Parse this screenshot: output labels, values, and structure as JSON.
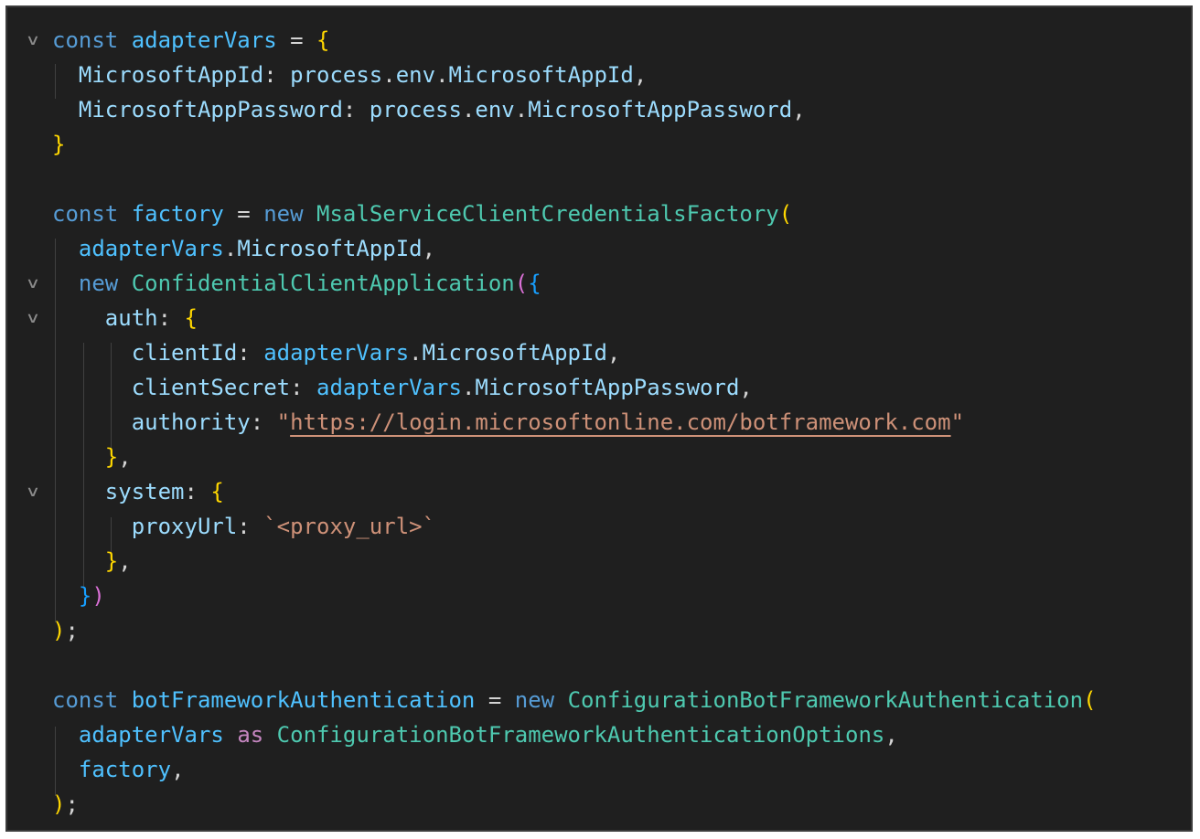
{
  "editor": {
    "theme": {
      "background": "#1f1f1f",
      "keyword": "#569cd6",
      "type": "#4ec9b0",
      "string": "#ce9178",
      "property": "#9cdcfe",
      "bracket_1": "#ffd700",
      "bracket_2": "#da70d6",
      "bracket_3": "#179fff"
    },
    "fold_icon": "chevron-down-icon",
    "lines": [
      {
        "fold": true,
        "tokens": [
          [
            "kw",
            "const"
          ],
          [
            "p",
            " "
          ],
          [
            "var",
            "adapterVars"
          ],
          [
            "p",
            " = "
          ],
          [
            "b1",
            "{"
          ]
        ]
      },
      {
        "fold": false,
        "tokens": [
          [
            "p",
            "  "
          ],
          [
            "prop",
            "MicrosoftAppId"
          ],
          [
            "p",
            ": "
          ],
          [
            "prop",
            "process"
          ],
          [
            "p",
            "."
          ],
          [
            "prop",
            "env"
          ],
          [
            "p",
            "."
          ],
          [
            "prop",
            "MicrosoftAppId"
          ],
          [
            "p",
            ","
          ]
        ]
      },
      {
        "fold": false,
        "tokens": [
          [
            "p",
            "  "
          ],
          [
            "prop",
            "MicrosoftAppPassword"
          ],
          [
            "p",
            ": "
          ],
          [
            "prop",
            "process"
          ],
          [
            "p",
            "."
          ],
          [
            "prop",
            "env"
          ],
          [
            "p",
            "."
          ],
          [
            "prop",
            "MicrosoftAppPassword"
          ],
          [
            "p",
            ","
          ]
        ]
      },
      {
        "fold": false,
        "tokens": [
          [
            "b1",
            "}"
          ]
        ]
      },
      {
        "fold": false,
        "tokens": []
      },
      {
        "fold": false,
        "tokens": [
          [
            "kw",
            "const"
          ],
          [
            "p",
            " "
          ],
          [
            "var",
            "factory"
          ],
          [
            "p",
            " = "
          ],
          [
            "kw",
            "new"
          ],
          [
            "p",
            " "
          ],
          [
            "cls",
            "MsalServiceClientCredentialsFactory"
          ],
          [
            "b1",
            "("
          ]
        ]
      },
      {
        "fold": false,
        "tokens": [
          [
            "p",
            "  "
          ],
          [
            "var",
            "adapterVars"
          ],
          [
            "p",
            "."
          ],
          [
            "prop",
            "MicrosoftAppId"
          ],
          [
            "p",
            ","
          ]
        ]
      },
      {
        "fold": true,
        "tokens": [
          [
            "p",
            "  "
          ],
          [
            "kw",
            "new"
          ],
          [
            "p",
            " "
          ],
          [
            "cls",
            "ConfidentialClientApplication"
          ],
          [
            "b2",
            "("
          ],
          [
            "b3",
            "{"
          ]
        ]
      },
      {
        "fold": true,
        "tokens": [
          [
            "p",
            "    "
          ],
          [
            "prop",
            "auth"
          ],
          [
            "p",
            ": "
          ],
          [
            "b1",
            "{"
          ]
        ]
      },
      {
        "fold": false,
        "tokens": [
          [
            "p",
            "      "
          ],
          [
            "prop",
            "clientId"
          ],
          [
            "p",
            ": "
          ],
          [
            "var",
            "adapterVars"
          ],
          [
            "p",
            "."
          ],
          [
            "prop",
            "MicrosoftAppId"
          ],
          [
            "p",
            ","
          ]
        ]
      },
      {
        "fold": false,
        "tokens": [
          [
            "p",
            "      "
          ],
          [
            "prop",
            "clientSecret"
          ],
          [
            "p",
            ": "
          ],
          [
            "var",
            "adapterVars"
          ],
          [
            "p",
            "."
          ],
          [
            "prop",
            "MicrosoftAppPassword"
          ],
          [
            "p",
            ","
          ]
        ]
      },
      {
        "fold": false,
        "tokens": [
          [
            "p",
            "      "
          ],
          [
            "prop",
            "authority"
          ],
          [
            "p",
            ": "
          ],
          [
            "str",
            "\""
          ],
          [
            "url",
            "https://login.microsoftonline.com/botframework.com"
          ],
          [
            "str",
            "\""
          ]
        ]
      },
      {
        "fold": false,
        "tokens": [
          [
            "p",
            "    "
          ],
          [
            "b1",
            "}"
          ],
          [
            "p",
            ","
          ]
        ]
      },
      {
        "fold": true,
        "tokens": [
          [
            "p",
            "    "
          ],
          [
            "prop",
            "system"
          ],
          [
            "p",
            ": "
          ],
          [
            "b1",
            "{"
          ]
        ]
      },
      {
        "fold": false,
        "tokens": [
          [
            "p",
            "      "
          ],
          [
            "prop",
            "proxyUrl"
          ],
          [
            "p",
            ": "
          ],
          [
            "str",
            "`<proxy_url>`"
          ]
        ]
      },
      {
        "fold": false,
        "tokens": [
          [
            "p",
            "    "
          ],
          [
            "b1",
            "}"
          ],
          [
            "p",
            ","
          ]
        ]
      },
      {
        "fold": false,
        "tokens": [
          [
            "p",
            "  "
          ],
          [
            "b3",
            "}"
          ],
          [
            "b2",
            ")"
          ]
        ]
      },
      {
        "fold": false,
        "tokens": [
          [
            "b1",
            ")"
          ],
          [
            "p",
            ";"
          ]
        ]
      },
      {
        "fold": false,
        "tokens": []
      },
      {
        "fold": false,
        "tokens": [
          [
            "kw",
            "const"
          ],
          [
            "p",
            " "
          ],
          [
            "var",
            "botFrameworkAuthentication"
          ],
          [
            "p",
            " = "
          ],
          [
            "kw",
            "new"
          ],
          [
            "p",
            " "
          ],
          [
            "cls",
            "ConfigurationBotFrameworkAuthentication"
          ],
          [
            "b1",
            "("
          ]
        ]
      },
      {
        "fold": false,
        "tokens": [
          [
            "p",
            "  "
          ],
          [
            "var",
            "adapterVars"
          ],
          [
            "p",
            " "
          ],
          [
            "kw2",
            "as"
          ],
          [
            "p",
            " "
          ],
          [
            "cls",
            "ConfigurationBotFrameworkAuthenticationOptions"
          ],
          [
            "p",
            ","
          ]
        ]
      },
      {
        "fold": false,
        "tokens": [
          [
            "p",
            "  "
          ],
          [
            "var",
            "factory"
          ],
          [
            "p",
            ","
          ]
        ]
      },
      {
        "fold": false,
        "tokens": [
          [
            "b1",
            ")"
          ],
          [
            "p",
            ";"
          ]
        ]
      }
    ]
  }
}
